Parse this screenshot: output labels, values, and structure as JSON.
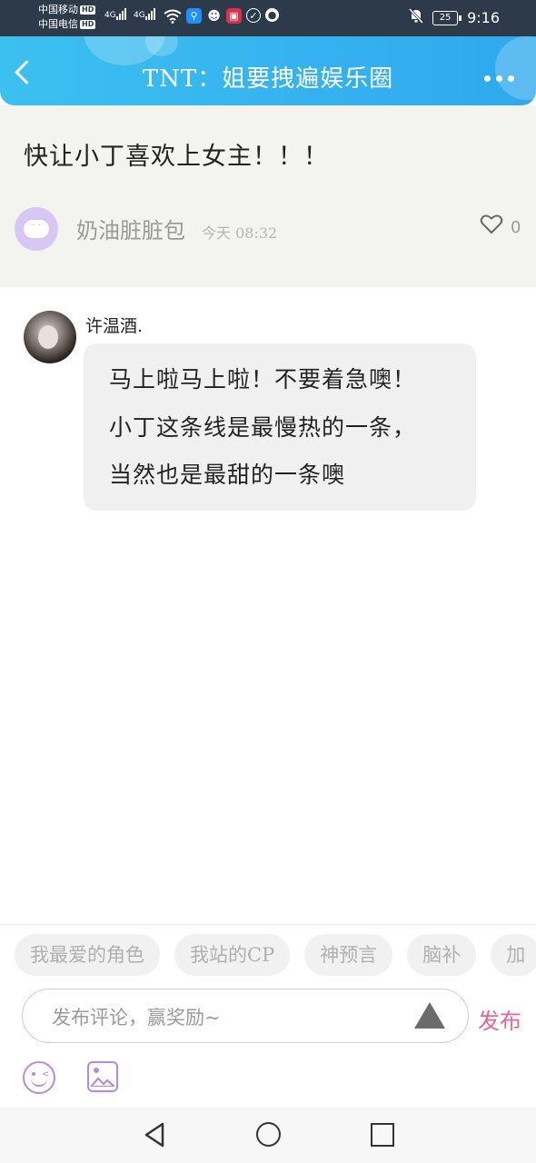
{
  "status_bar": {
    "carrier_1": "中国移动",
    "carrier_2": "中国电信",
    "hd_label": "HD",
    "network_label": "4G",
    "battery": "25",
    "time": "9:16"
  },
  "header": {
    "title": "TNT：姐要拽遍娱乐圈",
    "back_icon": "chevron-left-icon",
    "more_icon": "more-dots-icon",
    "color": "#35b5ef"
  },
  "post": {
    "text": "快让小丁喜欢上女主！！！",
    "author": "奶油脏脏包",
    "time": "今天 08:32",
    "likes": "0"
  },
  "comment": {
    "author": "许温酒.",
    "lines": [
      "马上啦马上啦！不要着急噢！",
      "小丁这条线是最慢热的一条，",
      "当然也是最甜的一条噢"
    ]
  },
  "quick_tags": [
    "我最爱的角色",
    "我站的CP",
    "神预言",
    "脑补",
    "加"
  ],
  "comment_input": {
    "placeholder": "发布评论，赢奖励~",
    "publish_label": "发布",
    "accent": "#e5649a"
  },
  "icons": {
    "emoji": "emoji-icon",
    "image": "image-icon",
    "nav_back": "triangle-back-icon",
    "nav_home": "circle-home-icon",
    "nav_recent": "square-recent-icon"
  }
}
